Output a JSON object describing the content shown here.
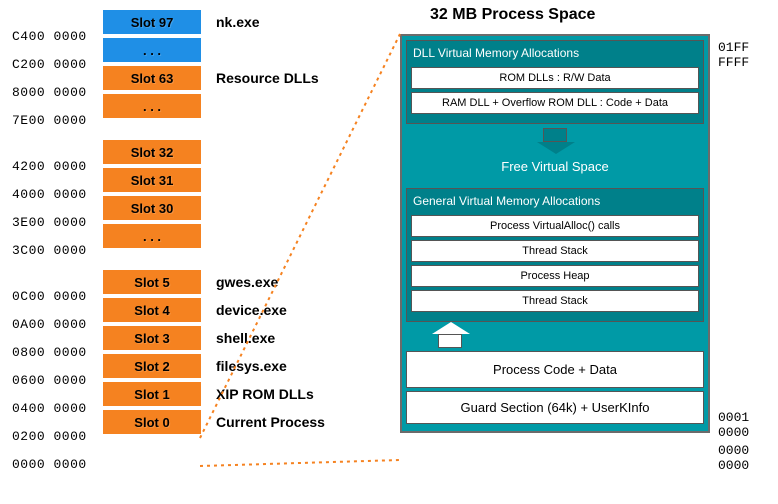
{
  "title": "32 MB  Process Space",
  "slots": [
    {
      "addr": "C400 0000",
      "label": "Slot 97",
      "desc": "nk.exe",
      "color": "blue"
    },
    {
      "addr": "C200 0000",
      "label": ". . .",
      "desc": "",
      "color": "blue"
    },
    {
      "addr": "8000 0000",
      "label": "Slot 63",
      "desc": "Resource DLLs",
      "color": "orange"
    },
    {
      "addr": "7E00 0000",
      "label": ". . .",
      "desc": "",
      "color": "orange"
    },
    {
      "addr": "4200 0000",
      "label": "Slot 32",
      "desc": "",
      "color": "orange"
    },
    {
      "addr": "4000 0000",
      "label": "Slot 31",
      "desc": "",
      "color": "orange"
    },
    {
      "addr": "3E00 0000",
      "label": "Slot 30",
      "desc": "",
      "color": "orange"
    },
    {
      "addr": "3C00 0000",
      "label": ". . .",
      "desc": "",
      "color": "orange"
    },
    {
      "addr": "0C00 0000",
      "label": "Slot 5",
      "desc": "gwes.exe",
      "color": "orange"
    },
    {
      "addr": "0A00 0000",
      "label": "Slot 4",
      "desc": "device.exe",
      "color": "orange"
    },
    {
      "addr": "0800 0000",
      "label": "Slot 3",
      "desc": "shell.exe",
      "color": "orange"
    },
    {
      "addr": "0600 0000",
      "label": "Slot 2",
      "desc": "filesys.exe",
      "color": "orange"
    },
    {
      "addr": "0400 0000",
      "label": "Slot 1",
      "desc": "XIP ROM DLLs",
      "color": "orange"
    },
    {
      "addr": "0200 0000",
      "label": "Slot 0",
      "desc": "Current Process",
      "color": "orange"
    },
    {
      "addr": "0000 0000",
      "label": "",
      "desc": "",
      "color": ""
    }
  ],
  "panel": {
    "dll_group_title": "DLL Virtual Memory Allocations",
    "rom_dlls": "ROM DLLs : R/W Data",
    "ram_dll": "RAM DLL + Overflow ROM DLL : Code + Data",
    "free": "Free Virtual Space",
    "gen_group_title": "General Virtual Memory Allocations",
    "virtualalloc": "Process VirtualAlloc() calls",
    "thread_stack1": "Thread Stack",
    "process_heap": "Process Heap",
    "thread_stack2": "Thread Stack",
    "process_code": "Process Code + Data",
    "guard": "Guard Section (64k) + UserKInfo"
  },
  "right_addr": {
    "top": "01FF FFFF",
    "mid": "0001 0000",
    "bottom": "0000 0000"
  }
}
